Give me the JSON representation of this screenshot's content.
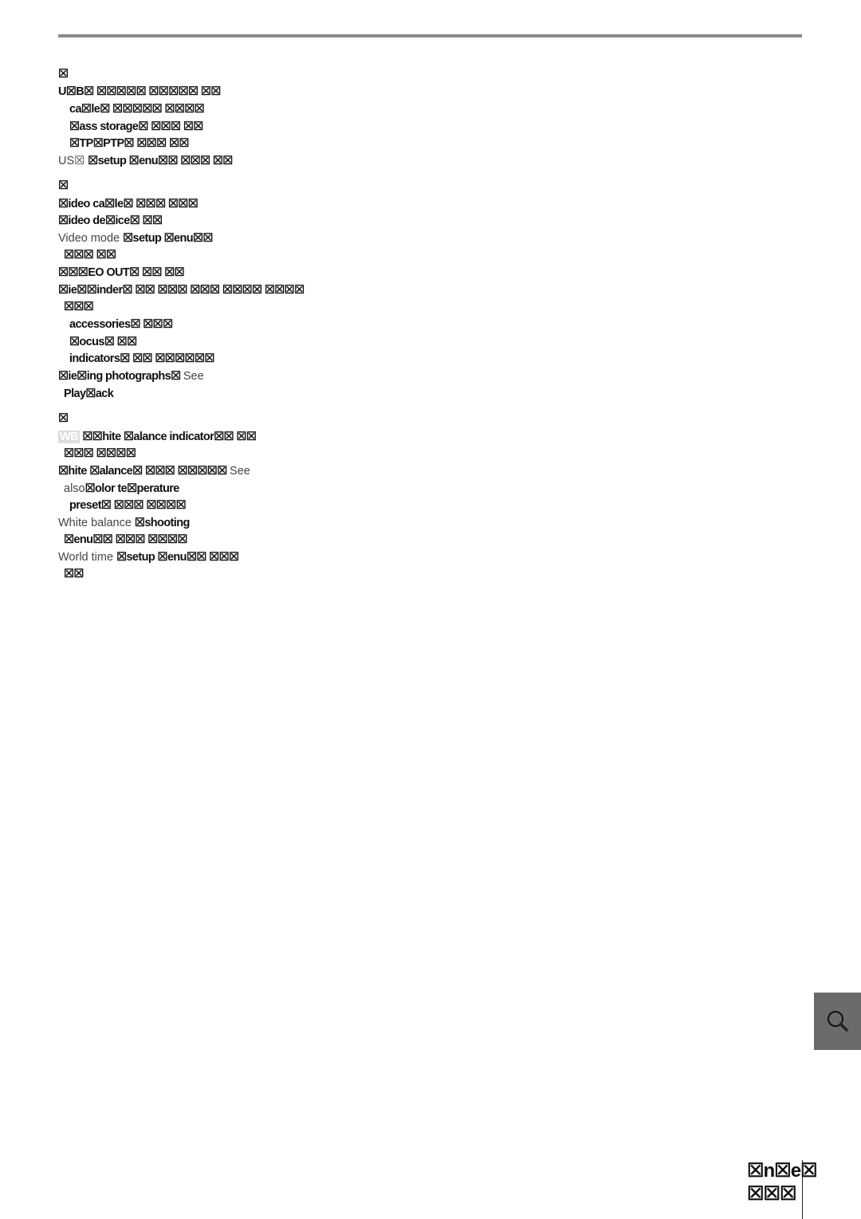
{
  "index_lines": [
    {
      "segs": [
        {
          "t": "☒",
          "w": "b"
        }
      ]
    },
    {
      "segs": [
        {
          "t": "U☒B☒ ☒☒☒☒☒ ☒☒☒☒☒ ☒☒",
          "w": "b"
        }
      ]
    },
    {
      "segs": [
        {
          "t": "ca☒le☒ ☒☒☒☒☒ ☒☒☒☒",
          "w": "b"
        }
      ]
    },
    {
      "segs": [
        {
          "t": "☒ass storage☒ ☒☒☒ ☒☒",
          "w": "b"
        }
      ]
    },
    {
      "segs": [
        {
          "t": "☒TP☒PTP☒ ☒☒☒ ☒☒",
          "w": "b"
        }
      ]
    },
    {
      "segs": [
        {
          "t": "US☒  ",
          "w": "l"
        },
        {
          "t": "☒setup ☒enu☒☒ ☒☒☒ ☒☒",
          "w": "b"
        }
      ]
    },
    {
      "segs": [
        {
          "t": "☒",
          "w": "b"
        }
      ]
    },
    {
      "segs": [
        {
          "t": "☒ideo ca☒le☒ ☒☒☒ ☒☒☒",
          "w": "b"
        }
      ]
    },
    {
      "segs": [
        {
          "t": "☒ideo de☒ice☒ ☒☒",
          "w": "b"
        }
      ]
    },
    {
      "segs": [
        {
          "t": "Video mode  ",
          "w": "l"
        },
        {
          "t": "☒setup ☒enu☒☒",
          "w": "b"
        }
      ]
    },
    {
      "segs": [
        {
          "t": "☒☒☒ ☒☒",
          "w": "b"
        }
      ]
    },
    {
      "segs": [
        {
          "t": "☒☒☒EO OUT☒ ☒☒ ☒☒",
          "w": "b"
        }
      ]
    },
    {
      "segs": [
        {
          "t": "☒ie☒☒inder☒ ☒☒ ☒☒☒ ☒☒☒ ☒☒☒☒ ☒☒☒☒",
          "w": "b"
        }
      ]
    },
    {
      "segs": [
        {
          "t": "☒☒☒",
          "w": "b"
        }
      ]
    },
    {
      "segs": [
        {
          "t": "accessories☒ ☒☒☒",
          "w": "b"
        }
      ]
    },
    {
      "segs": [
        {
          "t": "☒ocus☒ ☒☒",
          "w": "b"
        }
      ]
    },
    {
      "segs": [
        {
          "t": "indicators☒ ☒☒ ☒☒☒☒☒☒",
          "w": "b"
        }
      ]
    },
    {
      "segs": [
        {
          "t": "☒ie☒ing photographs☒   ",
          "w": "b"
        },
        {
          "t": "See",
          "w": "l"
        }
      ]
    },
    {
      "segs": [
        {
          "t": "Play☒ack",
          "w": "b"
        }
      ]
    },
    {
      "segs": [
        {
          "t": "☒",
          "w": "b"
        }
      ]
    },
    {
      "segs": [
        {
          "t": "WB",
          "w": "wb"
        },
        {
          "t": " ☒☒hite ☒alance indicator☒☒ ☒☒",
          "w": "b"
        }
      ]
    },
    {
      "segs": [
        {
          "t": "☒☒☒ ☒☒☒☒",
          "w": "b"
        }
      ]
    },
    {
      "segs": [
        {
          "t": "☒hite ☒alance☒ ☒☒☒ ☒☒☒☒☒   ",
          "w": "b"
        },
        {
          "t": "See",
          "w": "l"
        }
      ]
    },
    {
      "segs": [
        {
          "t": "also",
          "w": "l"
        },
        {
          "t": "☒olor te☒perature",
          "w": "b"
        }
      ]
    },
    {
      "segs": [
        {
          "t": "preset☒ ☒☒☒ ☒☒☒☒",
          "w": "b"
        }
      ]
    },
    {
      "segs": [
        {
          "t": "White balance  ",
          "w": "l"
        },
        {
          "t": "☒shooting",
          "w": "b"
        }
      ]
    },
    {
      "segs": [
        {
          "t": "☒enu☒☒ ☒☒☒ ☒☒☒☒",
          "w": "b"
        }
      ]
    },
    {
      "segs": [
        {
          "t": "World time  ",
          "w": "l"
        },
        {
          "t": "☒setup ☒enu☒☒ ☒☒☒",
          "w": "b"
        }
      ]
    },
    {
      "segs": [
        {
          "t": "☒☒",
          "w": "b"
        }
      ]
    }
  ],
  "side_tab": {
    "icon": "magnifier-icon",
    "color": "#6b6b6b"
  },
  "footer": {
    "page_label": "☒n☒e☒ ☒☒☒"
  }
}
